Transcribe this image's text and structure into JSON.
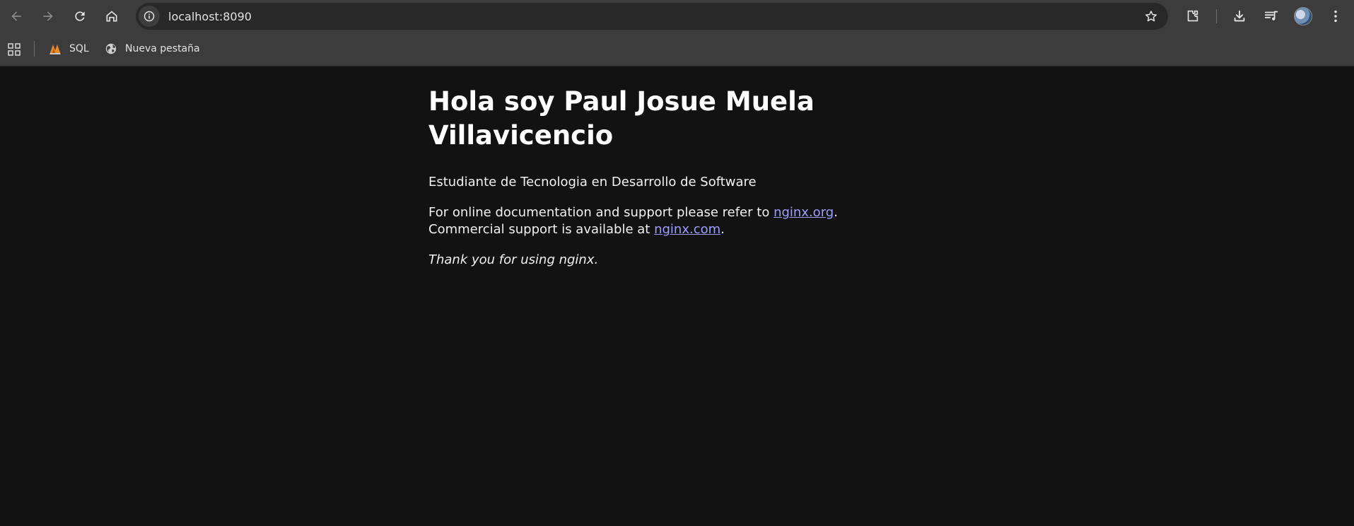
{
  "browser": {
    "url": "localhost:8090",
    "buttons": {
      "back": "back-arrow",
      "forward": "forward-arrow",
      "reload": "reload",
      "home": "home"
    },
    "bookmarks": [
      {
        "label": "SQL",
        "icon": "sql-logo-icon"
      },
      {
        "label": "Nueva pestaña",
        "icon": "globe-icon"
      }
    ],
    "colors": {
      "toolbar": "#3c3c3c",
      "omnibox": "#282828",
      "page_background": "#121212",
      "link": "#9e9eff"
    }
  },
  "page": {
    "title_line1": "Hola soy Paul Josue Muela",
    "title_line2": "Villavicencio",
    "subtitle": "Estudiante de Tecnologia en Desarrollo de Software",
    "doc_text_1": "For online documentation and support please refer to ",
    "doc_link_1": "nginx.org",
    "doc_text_2": ".",
    "doc_text_3": "Commercial support is available at ",
    "doc_link_2": "nginx.com",
    "doc_text_4": ".",
    "thanks": "Thank you for using nginx."
  }
}
